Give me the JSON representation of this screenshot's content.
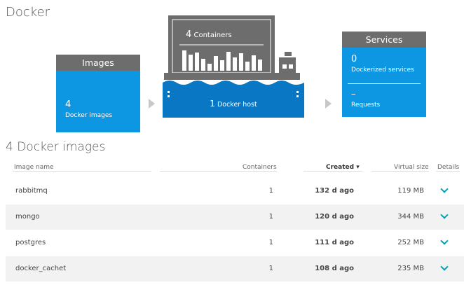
{
  "page": {
    "title": "Docker"
  },
  "overview": {
    "images": {
      "header": "Images",
      "count": "4",
      "label": "Docker images"
    },
    "host": {
      "containers_count": "4",
      "containers_label": "Containers",
      "host_count": "1",
      "host_label": "Docker host"
    },
    "services": {
      "header": "Services",
      "dockerized_count": "0",
      "dockerized_label": "Dockerized services",
      "requests_value": "–",
      "requests_label": "Requests"
    }
  },
  "table": {
    "title": "4 Docker images",
    "headers": {
      "image_name": "Image name",
      "containers": "Containers",
      "created": "Created ▾",
      "virtual_size": "Virtual size",
      "details": "Details"
    },
    "rows": [
      {
        "name": "rabbitmq",
        "containers": "1",
        "created": "132 d ago",
        "virtual_size": "119 MB"
      },
      {
        "name": "mongo",
        "containers": "1",
        "created": "120 d ago",
        "virtual_size": "344 MB"
      },
      {
        "name": "postgres",
        "containers": "1",
        "created": "111 d ago",
        "virtual_size": "252 MB"
      },
      {
        "name": "docker_cachet",
        "containers": "1",
        "created": "108 d ago",
        "virtual_size": "235 MB"
      }
    ]
  },
  "icons": {
    "expand": "chevron-down-icon",
    "sort": "sort-desc-indicator",
    "flow": "flow-arrow-icon",
    "host": "docker-ship-illustration"
  },
  "colors": {
    "tile_blue": "#0d96e2",
    "host_blue": "#0a77c5",
    "tile_header_gray": "#6d6d6d",
    "accent_teal": "#00a1b2",
    "row_alt": "#f2f2f2"
  }
}
